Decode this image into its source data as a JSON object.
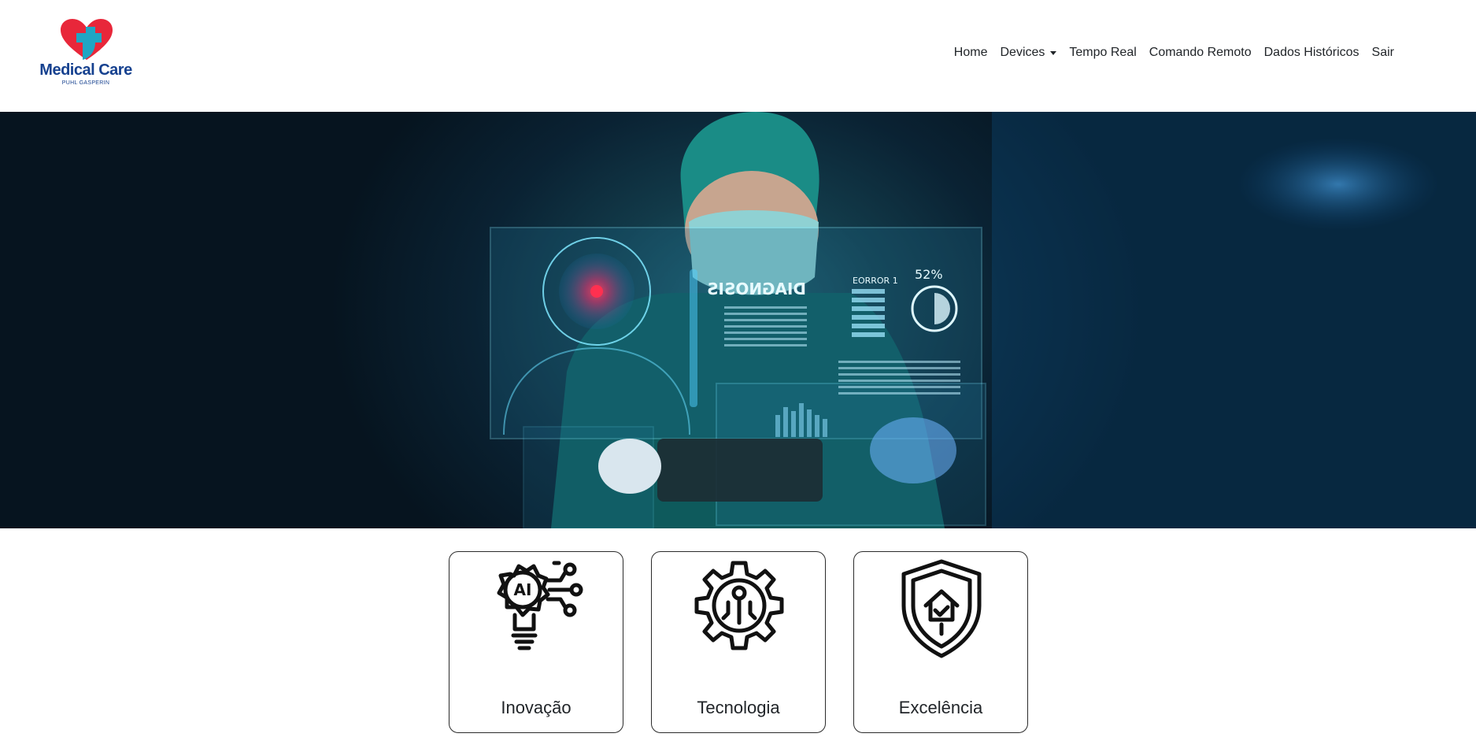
{
  "logo": {
    "title": "Medical Care",
    "subtitle": "PUHL GASPERIN"
  },
  "nav": {
    "home": "Home",
    "devices": "Devices",
    "tempo_real": "Tempo Real",
    "comando_remoto": "Comando Remoto",
    "dados_historicos": "Dados Históricos",
    "sair": "Sair"
  },
  "hero": {
    "panel_title": "DIAGNOSIS",
    "error_label": "EORROR 1",
    "percent": "52%"
  },
  "cards": [
    {
      "label": "Inovação",
      "icon": "ai-lightbulb-icon"
    },
    {
      "label": "Tecnologia",
      "icon": "gear-circuit-icon"
    },
    {
      "label": "Excelência",
      "icon": "shield-home-icon"
    }
  ],
  "colors": {
    "brand_blue": "#16418f",
    "brand_red": "#e8273a",
    "brand_teal": "#1fa6c4"
  }
}
